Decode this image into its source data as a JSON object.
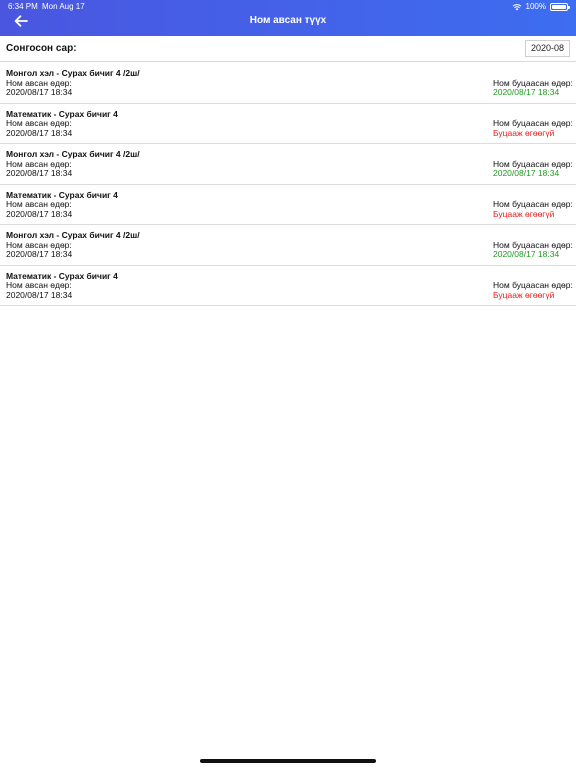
{
  "status_bar": {
    "time": "6:34 PM",
    "date": "Mon Aug 17",
    "battery": "100%"
  },
  "header": {
    "title": "Ном авсан түүх",
    "back_icon": "arrow-left-icon"
  },
  "filter": {
    "label": "Сонгосон сар:",
    "value": "2020-08"
  },
  "records": [
    {
      "name": "Монгол хэл - Сурах бичиг 4 /2ш/",
      "taken_label": "Ном авсан өдөр:",
      "taken_date": "2020/08/17 18:34",
      "returned_label": "Ном буцаасан өдөр:",
      "returned_value": "2020/08/17 18:34",
      "returned": true
    },
    {
      "name": "Математик - Сурах бичиг 4",
      "taken_label": "Ном авсан өдөр:",
      "taken_date": "2020/08/17 18:34",
      "returned_label": "Ном буцаасан өдөр:",
      "returned_value": "Буцааж өгөөгүй",
      "returned": false
    },
    {
      "name": "Монгол хэл - Сурах бичиг 4 /2ш/",
      "taken_label": "Ном авсан өдөр:",
      "taken_date": "2020/08/17 18:34",
      "returned_label": "Ном буцаасан өдөр:",
      "returned_value": "2020/08/17 18:34",
      "returned": true
    },
    {
      "name": "Математик - Сурах бичиг 4",
      "taken_label": "Ном авсан өдөр:",
      "taken_date": "2020/08/17 18:34",
      "returned_label": "Ном буцаасан өдөр:",
      "returned_value": "Буцааж өгөөгүй",
      "returned": false
    },
    {
      "name": "Монгол хэл - Сурах бичиг 4 /2ш/",
      "taken_label": "Ном авсан өдөр:",
      "taken_date": "2020/08/17 18:34",
      "returned_label": "Ном буцаасан өдөр:",
      "returned_value": "2020/08/17 18:34",
      "returned": true
    },
    {
      "name": "Математик - Сурах бичиг 4",
      "taken_label": "Ном авсан өдөр:",
      "taken_date": "2020/08/17 18:34",
      "returned_label": "Ном буцаасан өдөр:",
      "returned_value": "Буцааж өгөөгүй",
      "returned": false
    }
  ],
  "colors": {
    "header_start": "#4a56e0",
    "header_end": "#3d6df0",
    "returned": "#1f9a1f",
    "not_returned": "#e8201c"
  }
}
